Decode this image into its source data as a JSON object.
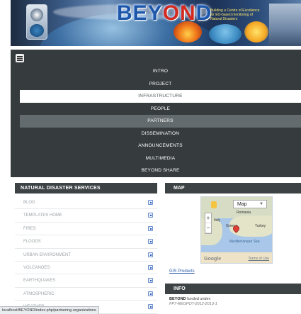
{
  "banner": {
    "title_main": "BEY",
    "title_accent": "ON",
    "title_end": "D",
    "subtitle": "Building a Centre of Excellence for EO-based monitoring of Natural Disasters"
  },
  "nav": {
    "items": [
      {
        "label": "INTRO"
      },
      {
        "label": "PROJECT"
      },
      {
        "label": "INFRASTRUCTURE"
      },
      {
        "label": "PEOPLE"
      },
      {
        "label": "PARTNERS"
      },
      {
        "label": "DISSEMINATION"
      },
      {
        "label": "ANNOUNCEMENTS"
      },
      {
        "label": "MULTIMEDIA"
      },
      {
        "label": "BEYOND SHARE"
      }
    ]
  },
  "services": {
    "title": "NATURAL DISASTER SERVICES",
    "items": [
      {
        "label": "BLOG"
      },
      {
        "label": "TEMPLATES HOME"
      },
      {
        "label": "FIRES"
      },
      {
        "label": "FLOODS"
      },
      {
        "label": "URBAN ENVIRONMENT"
      },
      {
        "label": "VOLCANOES"
      },
      {
        "label": "EARTHQUAKES"
      },
      {
        "label": "ATMOSPHERIC"
      },
      {
        "label": "WEATHER"
      }
    ]
  },
  "map": {
    "title": "MAP",
    "type_select": "Map",
    "labels": {
      "romania": "Romania",
      "turkey": "Turkey",
      "greece": "Greece",
      "sea": "Mediterranean Sea",
      "italy": "Italy"
    },
    "zoom_in": "+",
    "zoom_out": "−",
    "google": "Google",
    "terms": "Terms of Use",
    "gis_link": "GIS Products"
  },
  "info": {
    "title": "INFO",
    "brand": "BEYOND",
    "funded": "funded under:",
    "code": "FP7-REGPOT-2012-2013-1"
  },
  "status_url": "localhost/BEYOND/index.php/partnering-organizations"
}
